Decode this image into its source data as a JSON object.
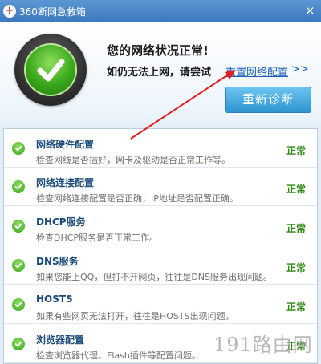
{
  "window": {
    "title": "360断网急救箱",
    "minimize_glyph": "—",
    "close_glyph": "×"
  },
  "header": {
    "status_title": "您的网络状况正常!",
    "hint_text": "如仍无法上网，请尝试",
    "reset_link": "重置网络配置",
    "reset_arrows": ">>",
    "rediagnose_button": "重新诊断"
  },
  "checks": [
    {
      "title": "网络硬件配置",
      "desc": "检查网线是否插好，网卡及驱动是否正常工作等。",
      "status": "正常"
    },
    {
      "title": "网络连接配置",
      "desc": "检查网络连接配置是否正确，IP地址是否配置正确。",
      "status": "正常"
    },
    {
      "title": "DHCP服务",
      "desc": "检查DHCP服务是否正常工作。",
      "status": "正常"
    },
    {
      "title": "DNS服务",
      "desc": "如果您能上QQ，但打不开网页，往往是DNS服务出现问题。",
      "status": "正常"
    },
    {
      "title": "HOSTS",
      "desc": "如果有些网页无法打开，往往是HOSTS出现问题。",
      "status": "正常"
    },
    {
      "title": "浏览器配置",
      "desc": "检查浏览器代理、Flash插件等配置问题。",
      "status": "正常"
    }
  ],
  "watermark": "191路由网",
  "colors": {
    "title_bar": "#3b78bd",
    "status_green": "#2f8a14",
    "link_blue": "#1a5fb4",
    "annotation_red": "#e02020"
  }
}
